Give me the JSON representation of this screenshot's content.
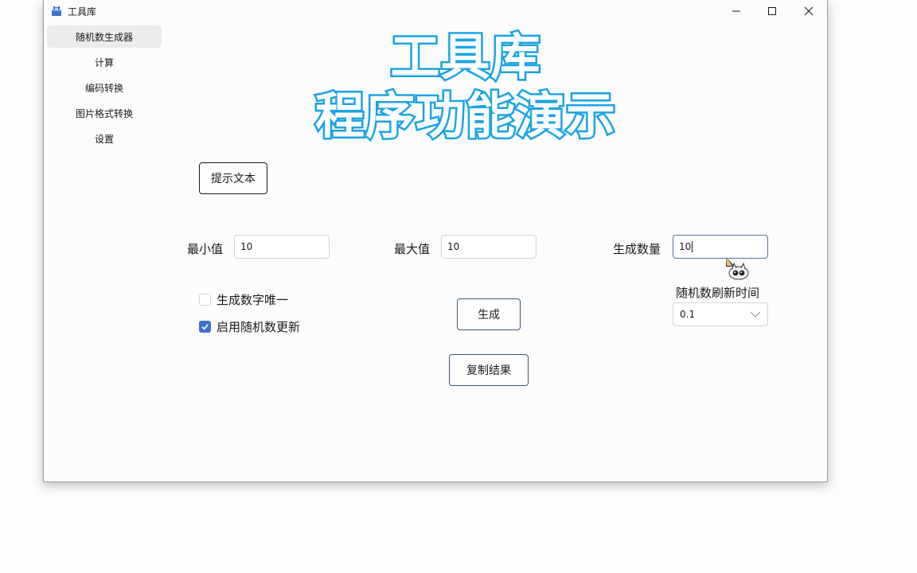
{
  "window": {
    "title": "工具库"
  },
  "sidebar": {
    "items": [
      {
        "label": "随机数生成器"
      },
      {
        "label": "计算"
      },
      {
        "label": "编码转换"
      },
      {
        "label": "图片格式转换"
      },
      {
        "label": "设置"
      }
    ]
  },
  "hero": {
    "line1": "工具库",
    "line2": "程序功能演示"
  },
  "hint_button": {
    "label": "提示文本"
  },
  "min_field": {
    "label": "最小值",
    "value": "10"
  },
  "max_field": {
    "label": "最大值",
    "value": "10"
  },
  "count_field": {
    "label": "生成数量",
    "value": "10"
  },
  "options": {
    "unique": {
      "label": "生成数字唯一",
      "checked": false
    },
    "auto_update": {
      "label": "启用随机数更新",
      "checked": true
    }
  },
  "generate_button": {
    "label": "生成"
  },
  "copy_button": {
    "label": "复制结果"
  },
  "refresh": {
    "label": "随机数刷新时间",
    "value": "0.1"
  },
  "colors": {
    "accent": "#3d6fcc",
    "hero_outline": "#1aa3e5",
    "button_border": "#3a5674"
  }
}
